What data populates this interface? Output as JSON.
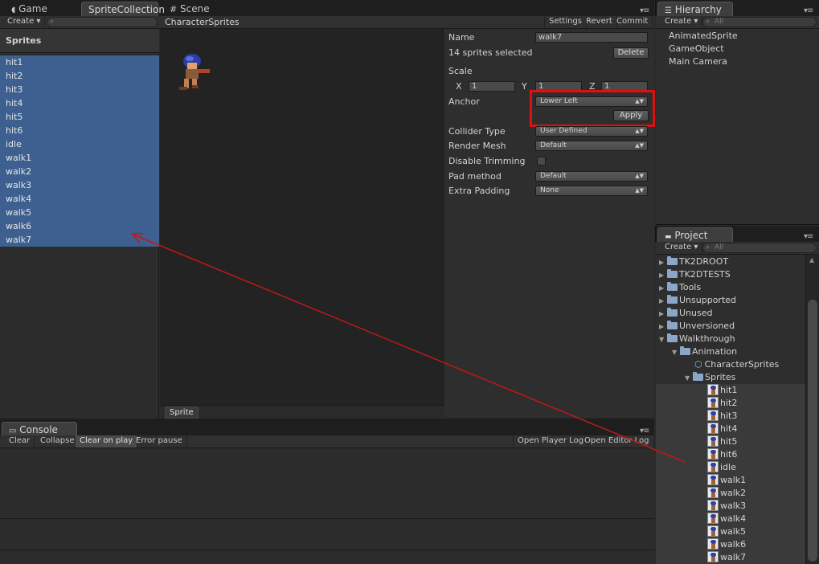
{
  "tabs": {
    "game": "Game",
    "sprite_collection": "SpriteCollection",
    "scene": "Scene",
    "hierarchy": "Hierarchy",
    "project": "Project",
    "console": "Console"
  },
  "toolbar": {
    "create": "Create ▾",
    "settings": "Settings",
    "revert": "Revert",
    "commit": "Commit",
    "search_placeholder": "All"
  },
  "collection_name": "CharacterSprites",
  "sprites_header": "Sprites",
  "sprite_list": [
    "hit1",
    "hit2",
    "hit3",
    "hit4",
    "hit5",
    "hit6",
    "idle",
    "walk1",
    "walk2",
    "walk3",
    "walk4",
    "walk5",
    "walk6",
    "walk7"
  ],
  "preview_label": "Sprite",
  "inspector": {
    "name_label": "Name",
    "name_value": "walk7",
    "selected_text": "14 sprites selected",
    "delete_label": "Delete",
    "scale_label": "Scale",
    "x_label": "X",
    "x_value": "1",
    "y_label": "Y",
    "y_value": "1",
    "z_label": "Z",
    "z_value": "1",
    "anchor_label": "Anchor",
    "anchor_value": "Lower Left",
    "apply_label": "Apply",
    "collider_label": "Collider Type",
    "collider_value": "User Defined",
    "render_mesh_label": "Render Mesh",
    "render_mesh_value": "Default",
    "disable_trimming_label": "Disable Trimming",
    "pad_method_label": "Pad method",
    "pad_method_value": "Default",
    "extra_padding_label": "Extra Padding",
    "extra_padding_value": "None"
  },
  "hierarchy_items": [
    "AnimatedSprite",
    "GameObject",
    "Main Camera"
  ],
  "project_tree": {
    "folders": [
      "TK2DROOT",
      "TK2DTESTS",
      "Tools",
      "Unsupported",
      "Unused",
      "Unversioned",
      "Walkthrough"
    ],
    "animation": "Animation",
    "character_sprites": "CharacterSprites",
    "sprites": "Sprites",
    "sprite_assets": [
      "hit1",
      "hit2",
      "hit3",
      "hit4",
      "hit5",
      "hit6",
      "idle",
      "walk1",
      "walk2",
      "walk3",
      "walk4",
      "walk5",
      "walk6",
      "walk7"
    ]
  },
  "console": {
    "clear": "Clear",
    "collapse": "Collapse",
    "clear_on_play": "Clear on play",
    "error_pause": "Error pause",
    "open_player_log": "Open Player Log",
    "open_editor_log": "Open Editor Log"
  },
  "colors": {
    "selection": "#3d6090",
    "highlight_box": "#e01010",
    "arrow": "#c01818"
  }
}
